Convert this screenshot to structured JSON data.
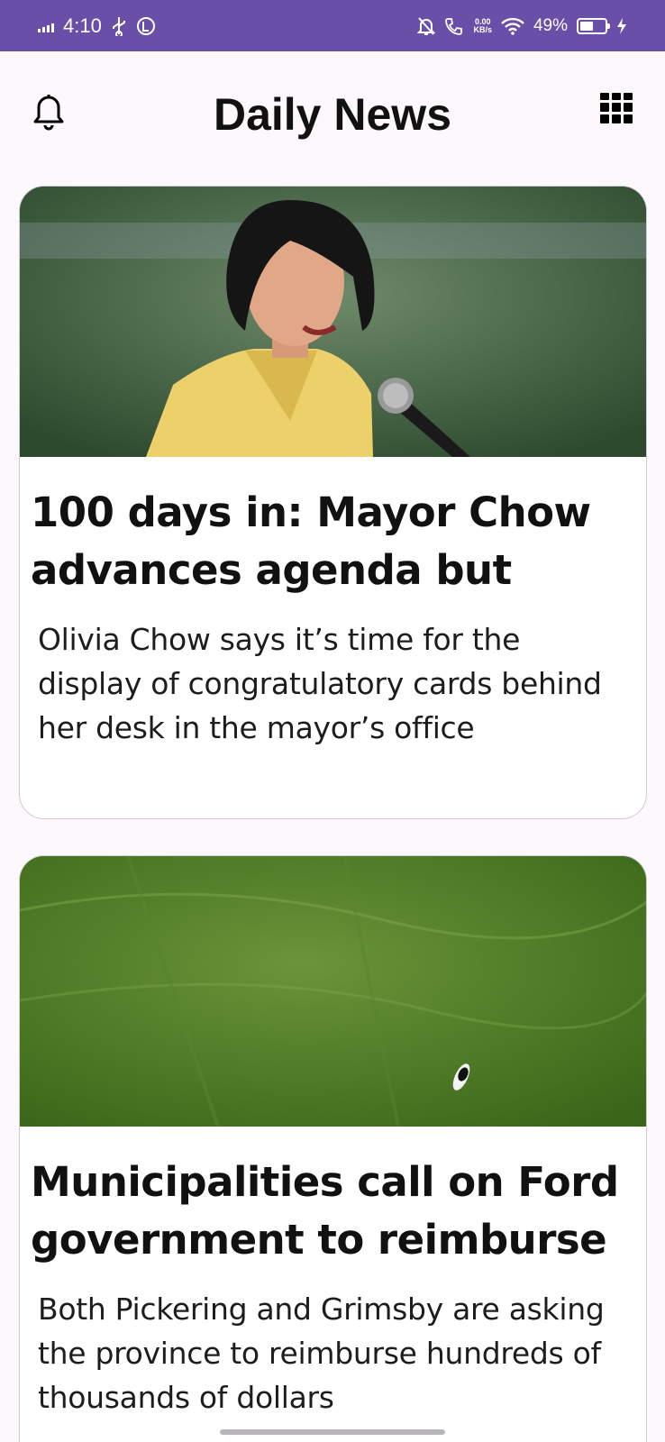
{
  "status_bar": {
    "time": "4:10",
    "network_speed_value": "0.00",
    "network_speed_unit": "KB/s",
    "battery_percent": "49%",
    "background_color": "#6a4fa8"
  },
  "app_bar": {
    "title": "Daily News",
    "left_icon": "bell-icon",
    "right_icon": "grid-menu-icon"
  },
  "articles": [
    {
      "image": "photo of a woman in a yellow blazer speaking at a microphone",
      "title": "100 days in: Mayor Chow advances agenda but",
      "summary": "Olivia Chow says it’s time for the display of congratulatory cards behind her desk in the mayor’s office"
    },
    {
      "image": "aerial photo of a green grass field with a dog",
      "title": "Municipalities call on Ford government to reimburse",
      "summary": "Both Pickering and Grimsby are asking the province to reimburse hundreds of thousands of dollars"
    }
  ]
}
